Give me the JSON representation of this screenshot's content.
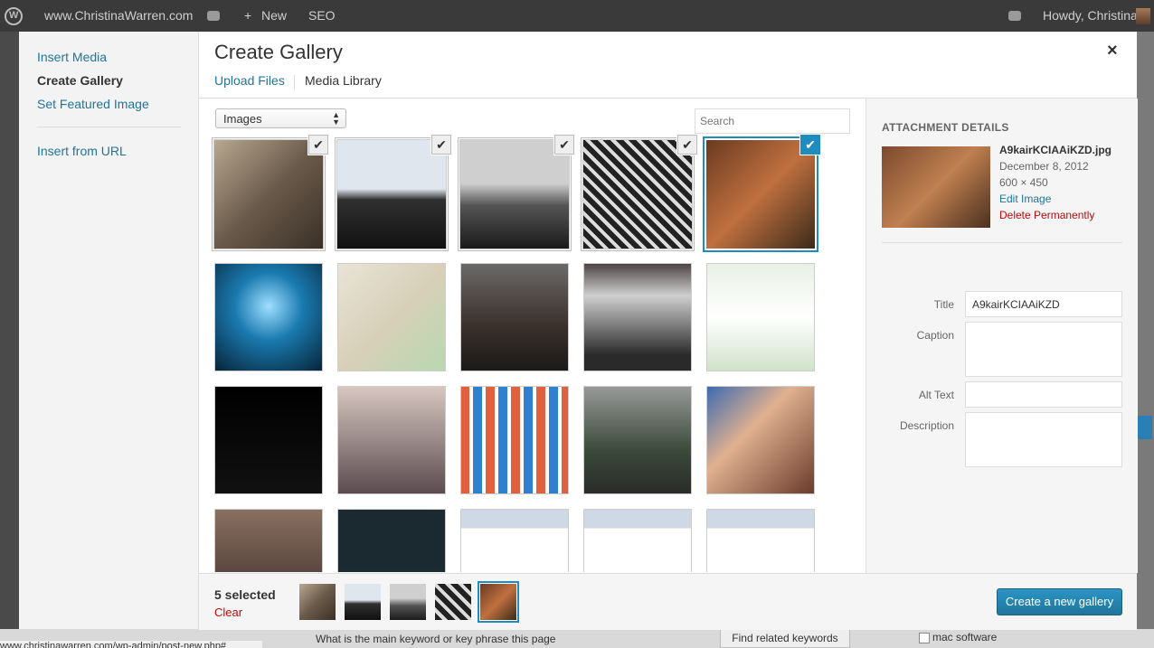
{
  "admin_bar": {
    "site": "www.ChristinaWarren.com",
    "new_label": "New",
    "seo_label": "SEO",
    "greeting": "Howdy, Christina"
  },
  "modal": {
    "menu": {
      "insert_media": "Insert Media",
      "create_gallery": "Create Gallery",
      "set_featured": "Set Featured Image",
      "insert_url": "Insert from URL"
    },
    "title": "Create Gallery",
    "close": "×",
    "tabs": {
      "upload": "Upload Files",
      "library": "Media Library"
    },
    "filter": {
      "selected": "Images"
    },
    "search": {
      "placeholder": "Search"
    }
  },
  "colors": {
    "accent": "#1e8cbe",
    "link": "#21759b",
    "delete": "#bc0b0b"
  },
  "check_icon": "✔",
  "attachments": [
    {
      "name": "woman-portrait",
      "bg": "linear-gradient(135deg,#b8a890,#6a5a4a,#3a3028)",
      "state": "sel"
    },
    {
      "name": "skyline-bw",
      "bg": "linear-gradient(#dfe6ee 45%,#303030 55%,#111)",
      "state": "sel"
    },
    {
      "name": "balcony-bw",
      "bg": "linear-gradient(#cfcfcf 40%,#555 60%,#1a1a1a)",
      "state": "sel"
    },
    {
      "name": "chain-fence",
      "bg": "repeating-linear-gradient(45deg,#222 0 6px,#ddd 6px 10px)",
      "state": "sel"
    },
    {
      "name": "guitar-group",
      "bg": "linear-gradient(135deg,#6a3a20,#c07040,#3a2a1a)",
      "state": "cur"
    },
    {
      "name": "concert-blue",
      "bg": "radial-gradient(circle at 50% 40%,#9fdfff,#1a7ab0 40%,#062236)",
      "state": ""
    },
    {
      "name": "map",
      "bg": "linear-gradient(135deg,#e8e4d8,#d8d0b8 50%,#b8d8b0)",
      "state": ""
    },
    {
      "name": "press-event",
      "bg": "linear-gradient(#6a6a6a,#3a2f2a 60%,#1a1a1a)",
      "state": ""
    },
    {
      "name": "laptop-screen",
      "bg": "linear-gradient(#4a4040,#cfcfcf 30%,#2a2a2a 85%)",
      "state": ""
    },
    {
      "name": "certificate",
      "bg": "linear-gradient(#e8f0e4,#ffffff 50%,#cfe2c8)",
      "state": ""
    },
    {
      "name": "battery-saver",
      "bg": "linear-gradient(#000,#111)",
      "state": ""
    },
    {
      "name": "video-woman",
      "bg": "linear-gradient(#d8c8c0,#5a4a50)",
      "state": ""
    },
    {
      "name": "app-grid",
      "bg": "repeating-linear-gradient(90deg,#e06040 0 10px,#fff 10px 14px,#3080d0 14px 24px,#fff 24px 28px)",
      "state": ""
    },
    {
      "name": "storefront",
      "bg": "linear-gradient(#9a9a9a,#3a4a3a 60%,#2a2a2a)",
      "state": ""
    },
    {
      "name": "woman-smile",
      "bg": "linear-gradient(135deg,#3a6ab0,#e0b090 40%,#6a3a2a)",
      "state": ""
    },
    {
      "name": "audience",
      "bg": "linear-gradient(#8a7060,#3a2a2a)",
      "state": ""
    },
    {
      "name": "future-of-web",
      "bg": "linear-gradient(#1a2a30,#1a2a30 55%,#1a6a8a)",
      "state": ""
    },
    {
      "name": "tweet-1",
      "bg": "linear-gradient(#cfd9e6 18%,#ffffff 18%)",
      "state": ""
    },
    {
      "name": "tweet-2",
      "bg": "linear-gradient(#cfd9e6 18%,#ffffff 18%)",
      "state": ""
    },
    {
      "name": "tweet-3",
      "bg": "linear-gradient(#cfd9e6 18%,#ffffff 18%)",
      "state": ""
    }
  ],
  "details": {
    "heading": "ATTACHMENT DETAILS",
    "filename": "A9kairKCIAAiKZD.jpg",
    "date": "December 8, 2012",
    "dimensions": "600 × 450",
    "edit_link": "Edit Image",
    "delete_link": "Delete Permanently",
    "title_label": "Title",
    "title_value": "A9kairKCIAAiKZD",
    "caption_label": "Caption",
    "alt_label": "Alt Text",
    "description_label": "Description"
  },
  "toolbar": {
    "count": "5 selected",
    "clear": "Clear",
    "button": "Create a new gallery"
  },
  "background": {
    "bottom_text": "What is the main keyword or key phrase this page",
    "related_btn": "Find related keywords",
    "mac_software": "mac software",
    "status_url": "www.christinawarren.com/wp-admin/post-new.php#"
  }
}
